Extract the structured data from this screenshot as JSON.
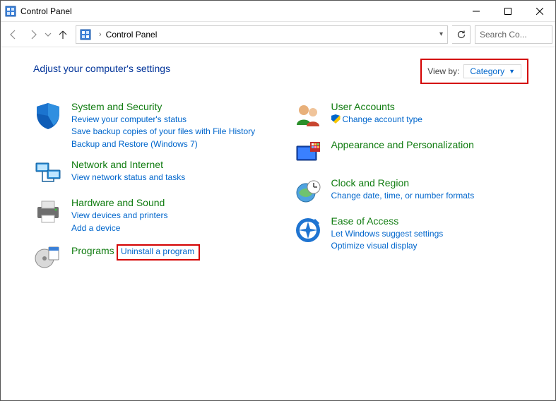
{
  "window": {
    "title": "Control Panel"
  },
  "address": {
    "location": "Control Panel"
  },
  "search": {
    "placeholder": "Search Co..."
  },
  "heading": "Adjust your computer's settings",
  "viewby": {
    "label": "View by:",
    "value": "Category"
  },
  "left": [
    {
      "title": "System and Security",
      "links": [
        {
          "text": "Review your computer's status"
        },
        {
          "text": "Save backup copies of your files with File History"
        },
        {
          "text": "Backup and Restore (Windows 7)"
        }
      ]
    },
    {
      "title": "Network and Internet",
      "links": [
        {
          "text": "View network status and tasks"
        }
      ]
    },
    {
      "title": "Hardware and Sound",
      "links": [
        {
          "text": "View devices and printers"
        },
        {
          "text": "Add a device"
        }
      ]
    },
    {
      "title": "Programs",
      "links": [
        {
          "text": "Uninstall a program",
          "highlight": true
        }
      ]
    }
  ],
  "right": [
    {
      "title": "User Accounts",
      "links": [
        {
          "text": "Change account type",
          "shield": true
        }
      ]
    },
    {
      "title": "Appearance and Personalization",
      "links": []
    },
    {
      "title": "Clock and Region",
      "links": [
        {
          "text": "Change date, time, or number formats"
        }
      ]
    },
    {
      "title": "Ease of Access",
      "links": [
        {
          "text": "Let Windows suggest settings"
        },
        {
          "text": "Optimize visual display"
        }
      ]
    }
  ]
}
